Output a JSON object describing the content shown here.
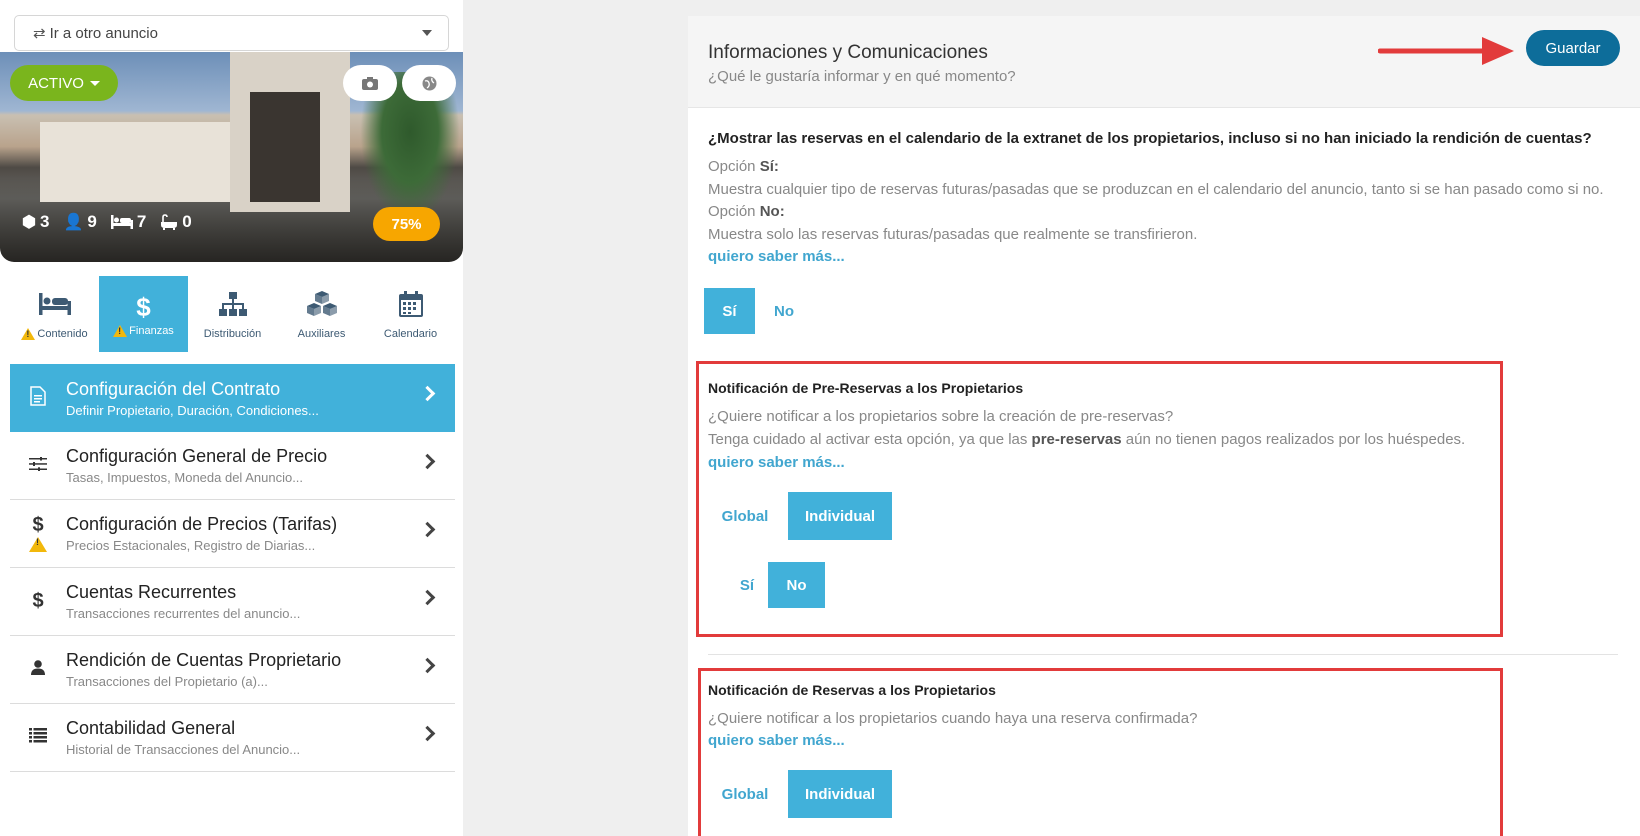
{
  "goto": {
    "label": "Ir a otro anuncio"
  },
  "listing": {
    "status": "ACTIVO",
    "stats": [
      {
        "icon": "cube-icon",
        "value": "3"
      },
      {
        "icon": "guests-icon",
        "value": "9"
      },
      {
        "icon": "bed-icon",
        "value": "7"
      },
      {
        "icon": "bath-icon",
        "value": "0"
      }
    ],
    "completion": "75%"
  },
  "tabs": [
    {
      "label": "Contenido",
      "icon": "bed-icon",
      "warning": true
    },
    {
      "label": "Finanzas",
      "icon": "dollar-icon",
      "warning": true
    },
    {
      "label": "Distribución",
      "icon": "sitemap-icon",
      "warning": false
    },
    {
      "label": "Auxiliares",
      "icon": "cubes-icon",
      "warning": false
    },
    {
      "label": "Calendario",
      "icon": "calendar-icon",
      "warning": false
    }
  ],
  "menu": [
    {
      "title": "Configuración del Contrato",
      "sub": "Definir Propietario, Duración, Condiciones...",
      "icon": "document-icon"
    },
    {
      "title": "Configuración General de Precio",
      "sub": "Tasas, Impuestos, Moneda del Anuncio...",
      "icon": "sliders-icon"
    },
    {
      "title": "Configuración de Precios (Tarifas)",
      "sub": "Precios Estacionales, Registro de Diarias...",
      "icon": "dollar-warning-icon"
    },
    {
      "title": "Cuentas Recurrentes",
      "sub": "Transacciones recurrentes del anuncio...",
      "icon": "dollar-icon"
    },
    {
      "title": "Rendición de Cuentas Proprietario",
      "sub": "Transacciones del Propietario (a)...",
      "icon": "user-icon"
    },
    {
      "title": "Contabilidad General",
      "sub": "Historial de Transacciones del Anuncio...",
      "icon": "list-icon"
    }
  ],
  "card": {
    "title": "Informaciones y Comunicaciones",
    "subtitle": "¿Qué le gustaría informar y en qué momento?",
    "save": "Guardar"
  },
  "section1": {
    "question": "¿Mostrar las reservas en el calendario de la extranet de los propietarios, incluso si no han iniciado la rendición de cuentas?",
    "opt_si_prefix": "Opción ",
    "opt_si_label": "Sí:",
    "opt_si_desc": "Muestra cualquier tipo de reservas futuras/pasadas que se produzcan en el calendario del anuncio, tanto si se han pasado como si no.",
    "opt_no_prefix": "Opción ",
    "opt_no_label": "No:",
    "opt_no_desc": "Muestra solo las reservas futuras/pasadas que realmente se transfirieron.",
    "more": "quiero saber más...",
    "yes": "Sí",
    "no": "No"
  },
  "section2": {
    "title": "Notificación de Pre-Reservas a los Propietarios",
    "question": "¿Quiere notificar a los propietarios sobre la creación de pre-reservas?",
    "warn_a": "Tenga cuidado al activar esta opción, ya que las ",
    "warn_b": "pre-reservas",
    "warn_c": " aún no tienen pagos realizados por los huéspedes.",
    "more": "quiero saber más...",
    "global": "Global",
    "individual": "Individual",
    "yes": "Sí",
    "no": "No"
  },
  "section3": {
    "title": "Notificación de Reservas a los Propietarios",
    "question": "¿Quiere notificar a los propietarios cuando haya una reserva confirmada?",
    "more": "quiero saber más...",
    "global": "Global",
    "individual": "Individual"
  }
}
